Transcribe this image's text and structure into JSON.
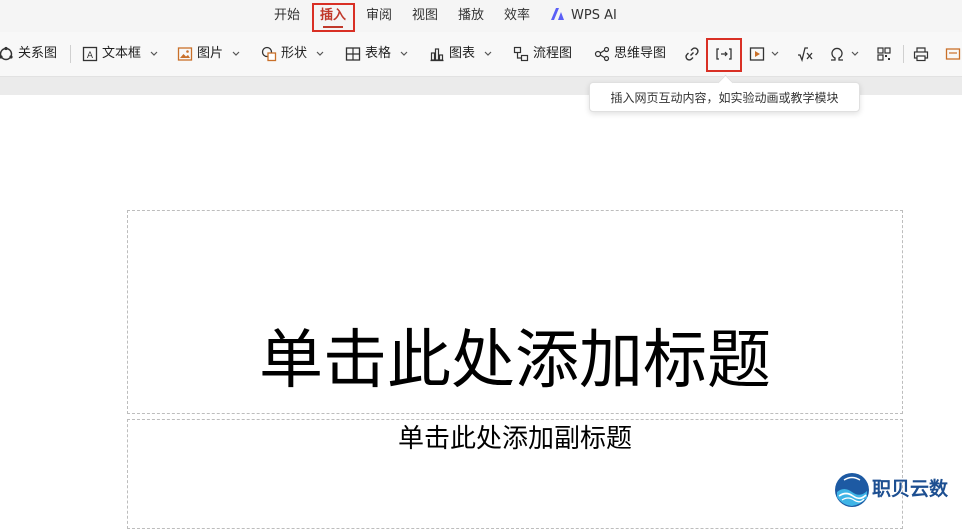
{
  "tabs": [
    {
      "label": "开始",
      "active": false
    },
    {
      "label": "插入",
      "active": true
    },
    {
      "label": "审阅",
      "active": false
    },
    {
      "label": "视图",
      "active": false
    },
    {
      "label": "播放",
      "active": false
    },
    {
      "label": "效率",
      "active": false
    }
  ],
  "wps_ai_label": "WPS AI",
  "ribbon": {
    "relation_label": "关系图",
    "textbox_label": "文本框",
    "picture_label": "图片",
    "shape_label": "形状",
    "table_label": "表格",
    "chart_label": "图表",
    "flowchart_label": "流程图",
    "mindmap_label": "思维导图"
  },
  "tooltip": "插入网页互动内容，如实验动画或教学模块",
  "slide": {
    "title_placeholder": "单击此处添加标题",
    "subtitle_placeholder": "单击此处添加副标题"
  },
  "watermark_text": "职贝云数",
  "colors": {
    "accent": "#c0392b",
    "highlight_box": "#d93025",
    "wps_ai": "#5b5ff6"
  },
  "icons": [
    "relation-icon",
    "textbox-icon",
    "picture-icon",
    "shape-icon",
    "table-icon",
    "chart-icon",
    "flowchart-icon",
    "mindmap-icon",
    "link-icon",
    "web-content-icon",
    "media-icon",
    "formula-icon",
    "symbol-icon",
    "qr-icon",
    "print-icon",
    "more-icon"
  ]
}
